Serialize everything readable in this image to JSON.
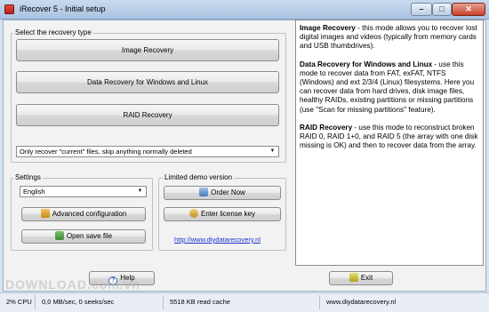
{
  "window": {
    "title": "iRecover 5 - Initial setup"
  },
  "recovery_type": {
    "group_label": "Select the recovery type",
    "buttons": [
      "Image Recovery",
      "Data Recovery for Windows and Linux",
      "RAID Recovery"
    ],
    "filter_select": "Only recover \"current\" files, skip anything normally deleted"
  },
  "settings": {
    "group_label": "Settings",
    "language": "English",
    "advanced_label": "Advanced configuration",
    "open_save_label": "Open save file"
  },
  "demo": {
    "group_label": "Limited demo version",
    "order_label": "Order Now",
    "license_label": "Enter license key",
    "link": "http://www.diydatarecovery.nl"
  },
  "help_label": "Help",
  "exit_label": "Exit",
  "info": {
    "p1_title": "Image Recovery",
    "p1_text": " - this mode allows you to recover lost digital images and videos (typically from memory cards and USB thumbdrives).",
    "p2_title": "Data Recovery for Windows and Linux",
    "p2_text": " - use this mode to recover data from FAT, exFAT, NTFS (Windows) and ext 2/3/4 (Linux) filesystems. Here you can recover data from hard drives, disk image files, healthy RAIDs, existing partitions or missing partitions (use \"Scan for missing partitions\" feature).",
    "p3_title": "RAID Recovery",
    "p3_text": " - use this mode to reconstruct broken RAID 0, RAID 1+0, and RAID 5 (the array with one disk missing is OK) and then to recover data from the array."
  },
  "status": {
    "cpu": "2% CPU",
    "io": "0,0 MB/sec, 0 seeks/sec",
    "cache": "5518 KB read cache",
    "site": "www.diydatarecovery.nl"
  },
  "watermark": "DOWNLOAD.com.vn"
}
